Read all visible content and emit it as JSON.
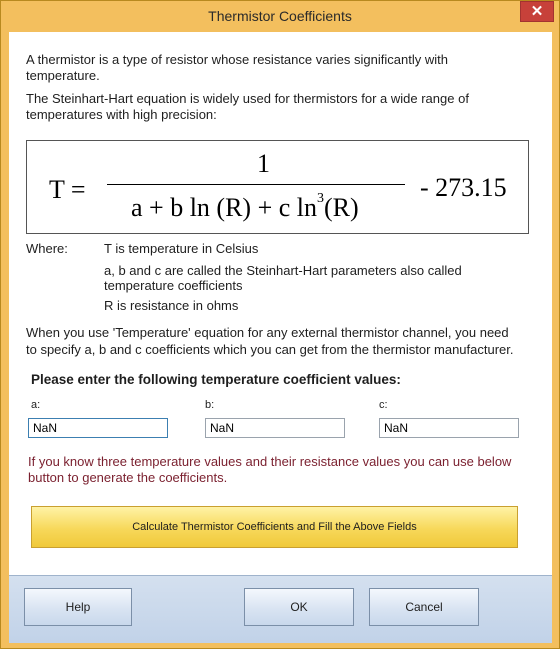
{
  "window": {
    "title": "Thermistor Coefficients",
    "close_glyph": "✕"
  },
  "intro": {
    "line1": "A thermistor is a type of resistor whose resistance varies significantly with",
    "line2": "temperature.",
    "line3": "The Steinhart-Hart equation is widely used for thermistors for a wide range of",
    "line4": "temperatures with high precision:"
  },
  "formula": {
    "lhs": "T =",
    "numerator": "1",
    "denominator_part1": "a + b ln (R) + c ln",
    "exponent": "3",
    "denominator_part2": "(R)",
    "constant": "- 273.15"
  },
  "where": {
    "label": "Where:",
    "line1": "T is temperature in Celsius",
    "line2": "a, b and c are called the Steinhart-Hart parameters also called",
    "line3": "temperature coefficients",
    "line4": "R is resistance in ohms"
  },
  "usage": {
    "line1": "When you use 'Temperature' equation for any external thermistor channel, you need",
    "line2": "to specify a, b and c coefficients which you can get from the thermistor manufacturer."
  },
  "prompt": "Please enter the following temperature coefficient values:",
  "fields": {
    "a_label": "a:",
    "a_value": "NaN",
    "b_label": "b:",
    "b_value": "NaN",
    "c_label": "c:",
    "c_value": "NaN"
  },
  "hint": {
    "line1": "If you know three temperature values and their resistance values you can use below",
    "line2": "button to generate the coefficients."
  },
  "buttons": {
    "calculate": "Calculate Thermistor Coefficients and Fill the Above Fields",
    "help": "Help",
    "ok": "OK",
    "cancel": "Cancel"
  }
}
